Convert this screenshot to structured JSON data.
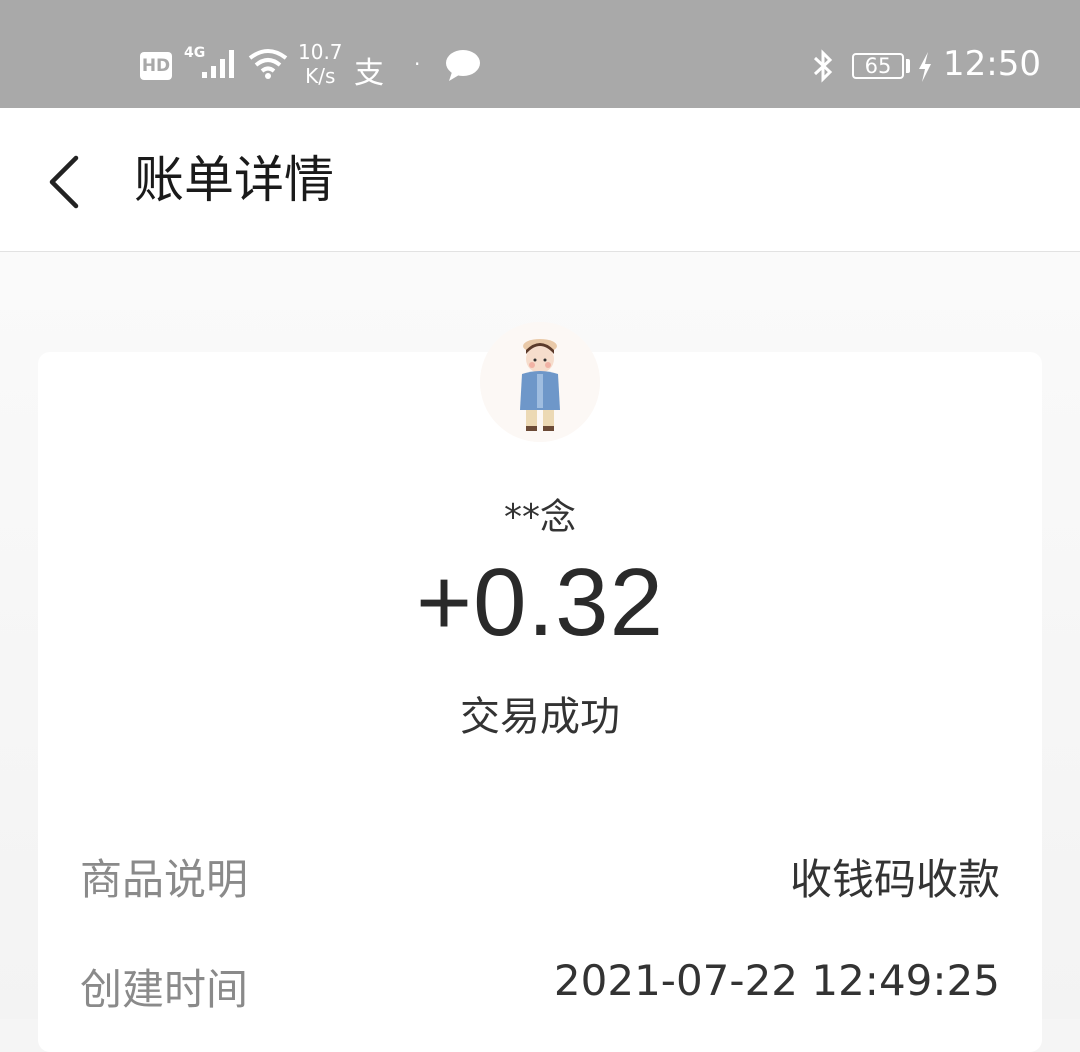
{
  "status_bar": {
    "hd": "HD",
    "network": "4G",
    "speed_value": "10.7",
    "speed_unit": "K/s",
    "alipay_glyph": "支",
    "battery": "65",
    "time": "12:50",
    "icons": [
      "signal-icon",
      "wifi-icon",
      "chat-bubble-icon",
      "bluetooth-icon",
      "charging-icon"
    ]
  },
  "header": {
    "title": "账单详情",
    "back_icon": "chevron-left-icon"
  },
  "bill": {
    "payer": "**念",
    "amount": "+0.32",
    "status": "交易成功",
    "rows": [
      {
        "label": "商品说明",
        "value": "收钱码收款"
      },
      {
        "label": "创建时间",
        "value": "2021-07-22 12:49:25"
      }
    ]
  },
  "colors": {
    "status_bar_bg": "#a9a9a9",
    "primary_text": "#333333",
    "secondary_text": "#8a8a8a",
    "page_bg": "#f5f5f5"
  }
}
